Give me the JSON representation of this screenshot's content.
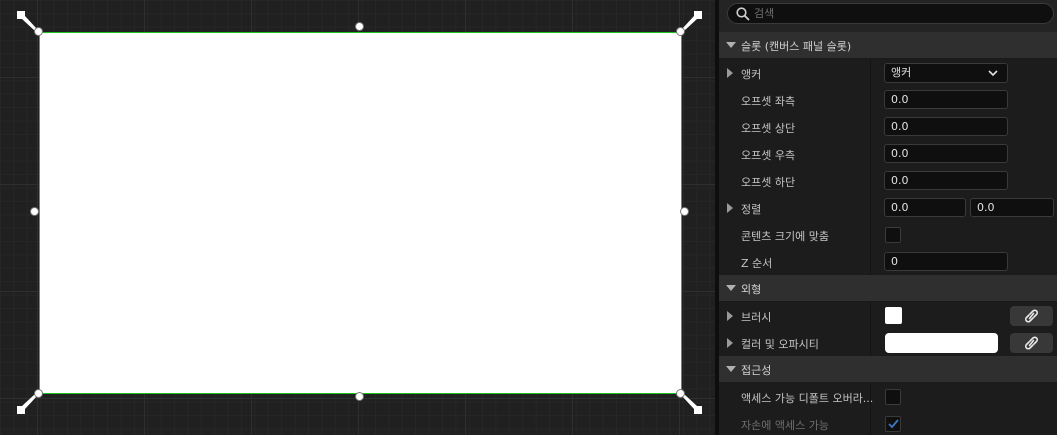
{
  "search": {
    "placeholder": "검색",
    "value": ""
  },
  "sections": {
    "slot": {
      "title": "슬롯 (캔버스 패널 슬롯)",
      "anchor_label": "앵커",
      "anchor_value": "앵커",
      "offset_left_label": "오프셋 좌측",
      "offset_left_value": "0.0",
      "offset_top_label": "오프셋 상단",
      "offset_top_value": "0.0",
      "offset_right_label": "오프셋 우측",
      "offset_right_value": "0.0",
      "offset_bottom_label": "오프셋 하단",
      "offset_bottom_value": "0.0",
      "alignment_label": "정렬",
      "alignment_x": "0.0",
      "alignment_y": "0.0",
      "size_to_content_label": "콘텐츠 크기에 맞춤",
      "size_to_content_checked": false,
      "z_order_label": "Z 순서",
      "z_order_value": "0"
    },
    "appearance": {
      "title": "외형",
      "brush_label": "브러시",
      "brush_color": "#ffffff",
      "color_opacity_label": "컬러 및 오파시티",
      "color_opacity_color": "#ffffff"
    },
    "accessibility": {
      "title": "접근성",
      "override_default_label": "액세스 가능 디폴트 오버라...",
      "override_default_checked": false,
      "children_accessible_label": "자손에 액세스 가능",
      "children_accessible_checked": true
    }
  },
  "colors": {
    "selection_outline": "#19c319",
    "widget_fill": "#ffffff",
    "canvas_bg": "#202020",
    "panel_bg": "#242424",
    "check_color": "#3a78c2"
  },
  "icons": {
    "search": "search-icon",
    "dropdown": "chevron-down-icon",
    "link": "link-icon",
    "anchor_handles": "anchor-flower-icon",
    "checkmark": "checkmark-icon"
  }
}
